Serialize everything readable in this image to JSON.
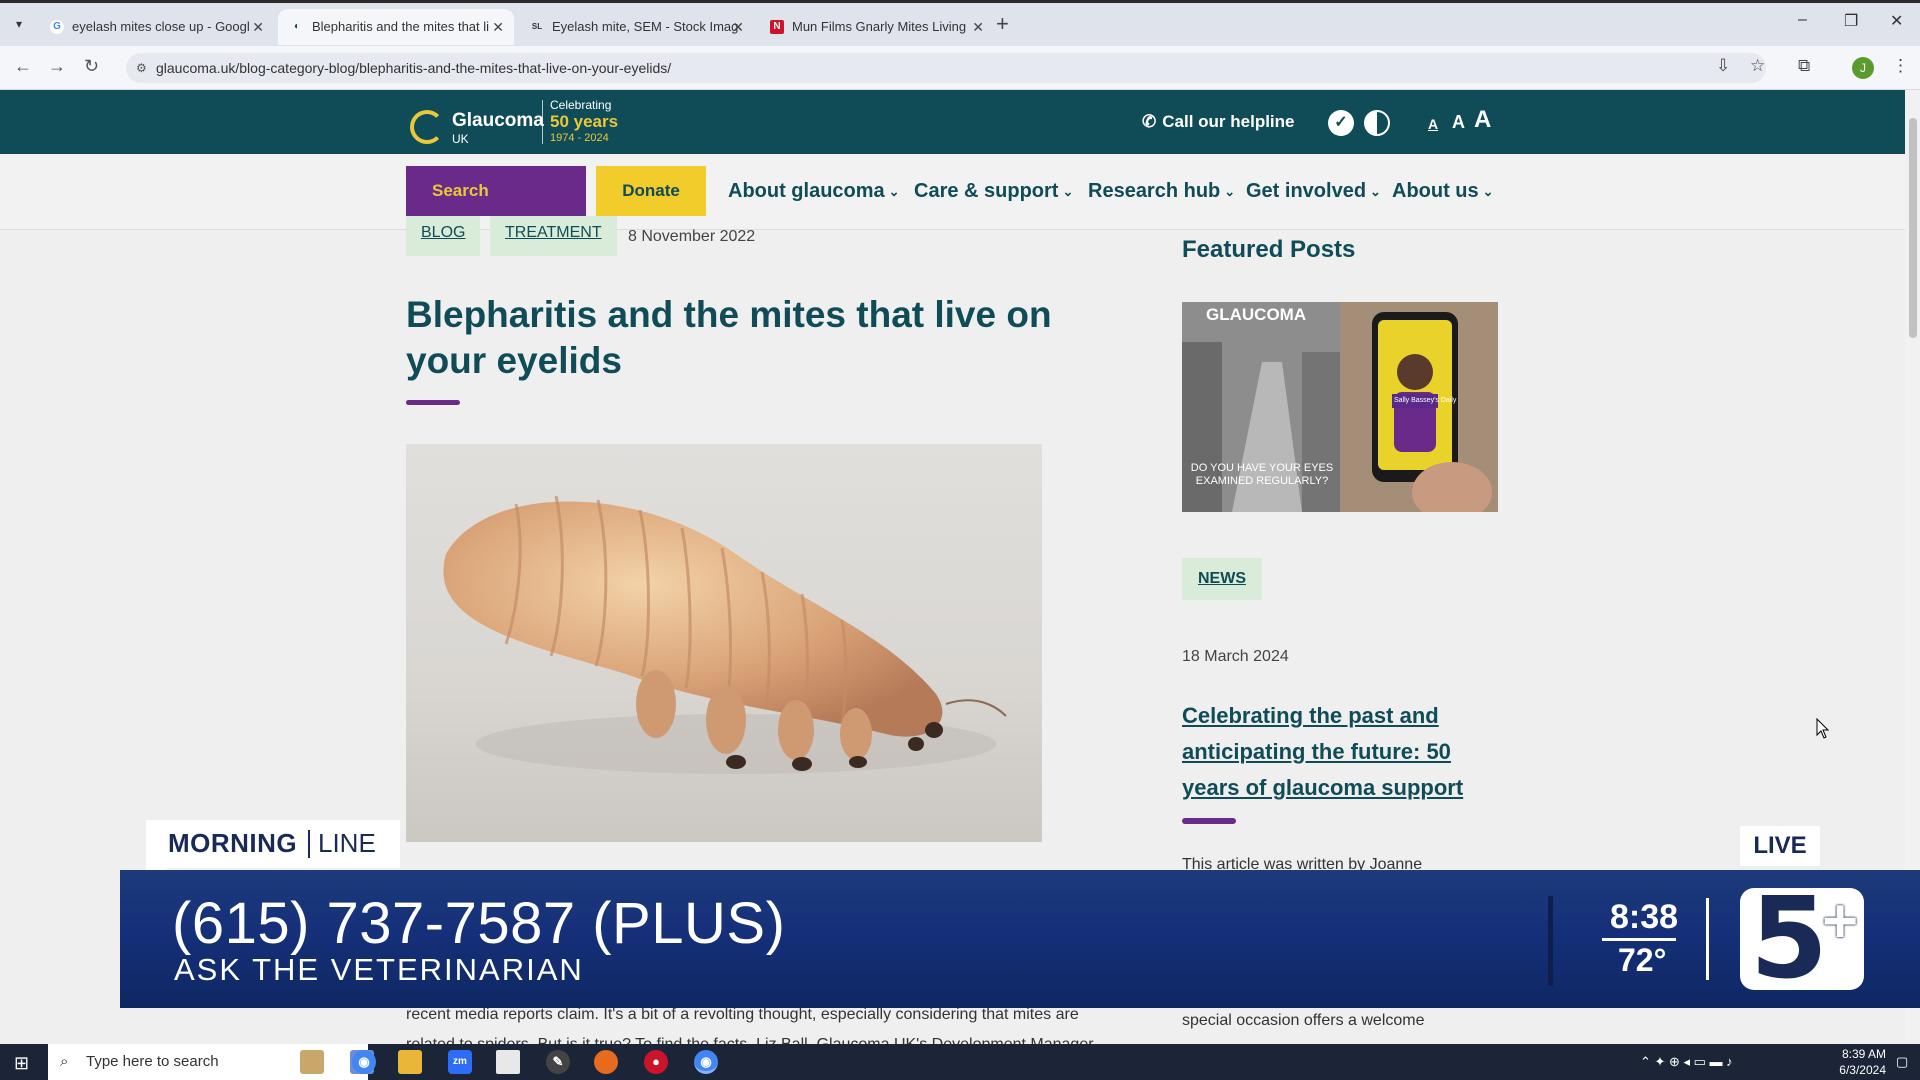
{
  "browser": {
    "tabs": [
      {
        "label": "eyelash mites close up - Googl",
        "favicon": "G",
        "active": false
      },
      {
        "label": "Blepharitis and the mites that li",
        "favicon": "◐",
        "active": true
      },
      {
        "label": "Eyelash mite, SEM - Stock Imag",
        "favicon": "SL",
        "active": false
      },
      {
        "label": "Mun Films Gnarly Mites Living",
        "favicon": "N",
        "active": false
      }
    ],
    "url": "glaucoma.uk/blog-category-blog/blepharitis-and-the-mites-that-live-on-your-eyelids/",
    "profile_initial": "J"
  },
  "site": {
    "logo": {
      "name": "Glaucoma",
      "sub": "UK",
      "celebrating": "Celebrating",
      "years": "50 years",
      "range": "1974 - 2024"
    },
    "helpline": "Call our helpline",
    "font_sizes": [
      "A",
      "A",
      "A"
    ],
    "nav": {
      "search": "Search",
      "donate": "Donate",
      "menu": [
        "About glaucoma",
        "Care & support",
        "Research hub",
        "Get involved",
        "About us"
      ]
    }
  },
  "article": {
    "tags": [
      "BLOG",
      "TREATMENT"
    ],
    "date": "8 November 2022",
    "title": "Blepharitis and the mites that live on your eyelids",
    "body_line1": "recent media reports claim. It's a bit of a revolting thought, especially considering that mites are",
    "body_line2": "related to spiders. But is it true? To find the facts, Liz Ball, Glaucoma UK's Development Manager,"
  },
  "featured": {
    "heading": "Featured Posts",
    "image_text_top": "GLAUCOMA",
    "image_text_bottom": "DO YOU HAVE YOUR EYES EXAMINED REGULARLY?",
    "image_phone_text": "Sally Bassey's Daily",
    "tag": "NEWS",
    "date": "18 March 2024",
    "title": "Celebrating the past and anticipating the future: 50 years of glaucoma support",
    "byline": "This article was written by Joanne",
    "tail": "special occasion offers a welcome"
  },
  "tv_overlay": {
    "program_left": "MORNING",
    "program_right": "LINE",
    "live": "LIVE",
    "phone": "(615) 737-7587 (PLUS)",
    "caption": "ASK THE VETERINARIAN",
    "time": "8:38",
    "temp": "72°",
    "station_num": "5",
    "station_plus": "+"
  },
  "taskbar": {
    "search_placeholder": "Type here to search",
    "time": "8:39 AM",
    "date": "6/3/2024"
  },
  "colors": {
    "teal": "#0f4c57",
    "purple": "#6a2a8a",
    "yellow": "#f2cc2a",
    "tag_bg": "#d8ecd9",
    "tv_blue": "#1a2a56"
  }
}
